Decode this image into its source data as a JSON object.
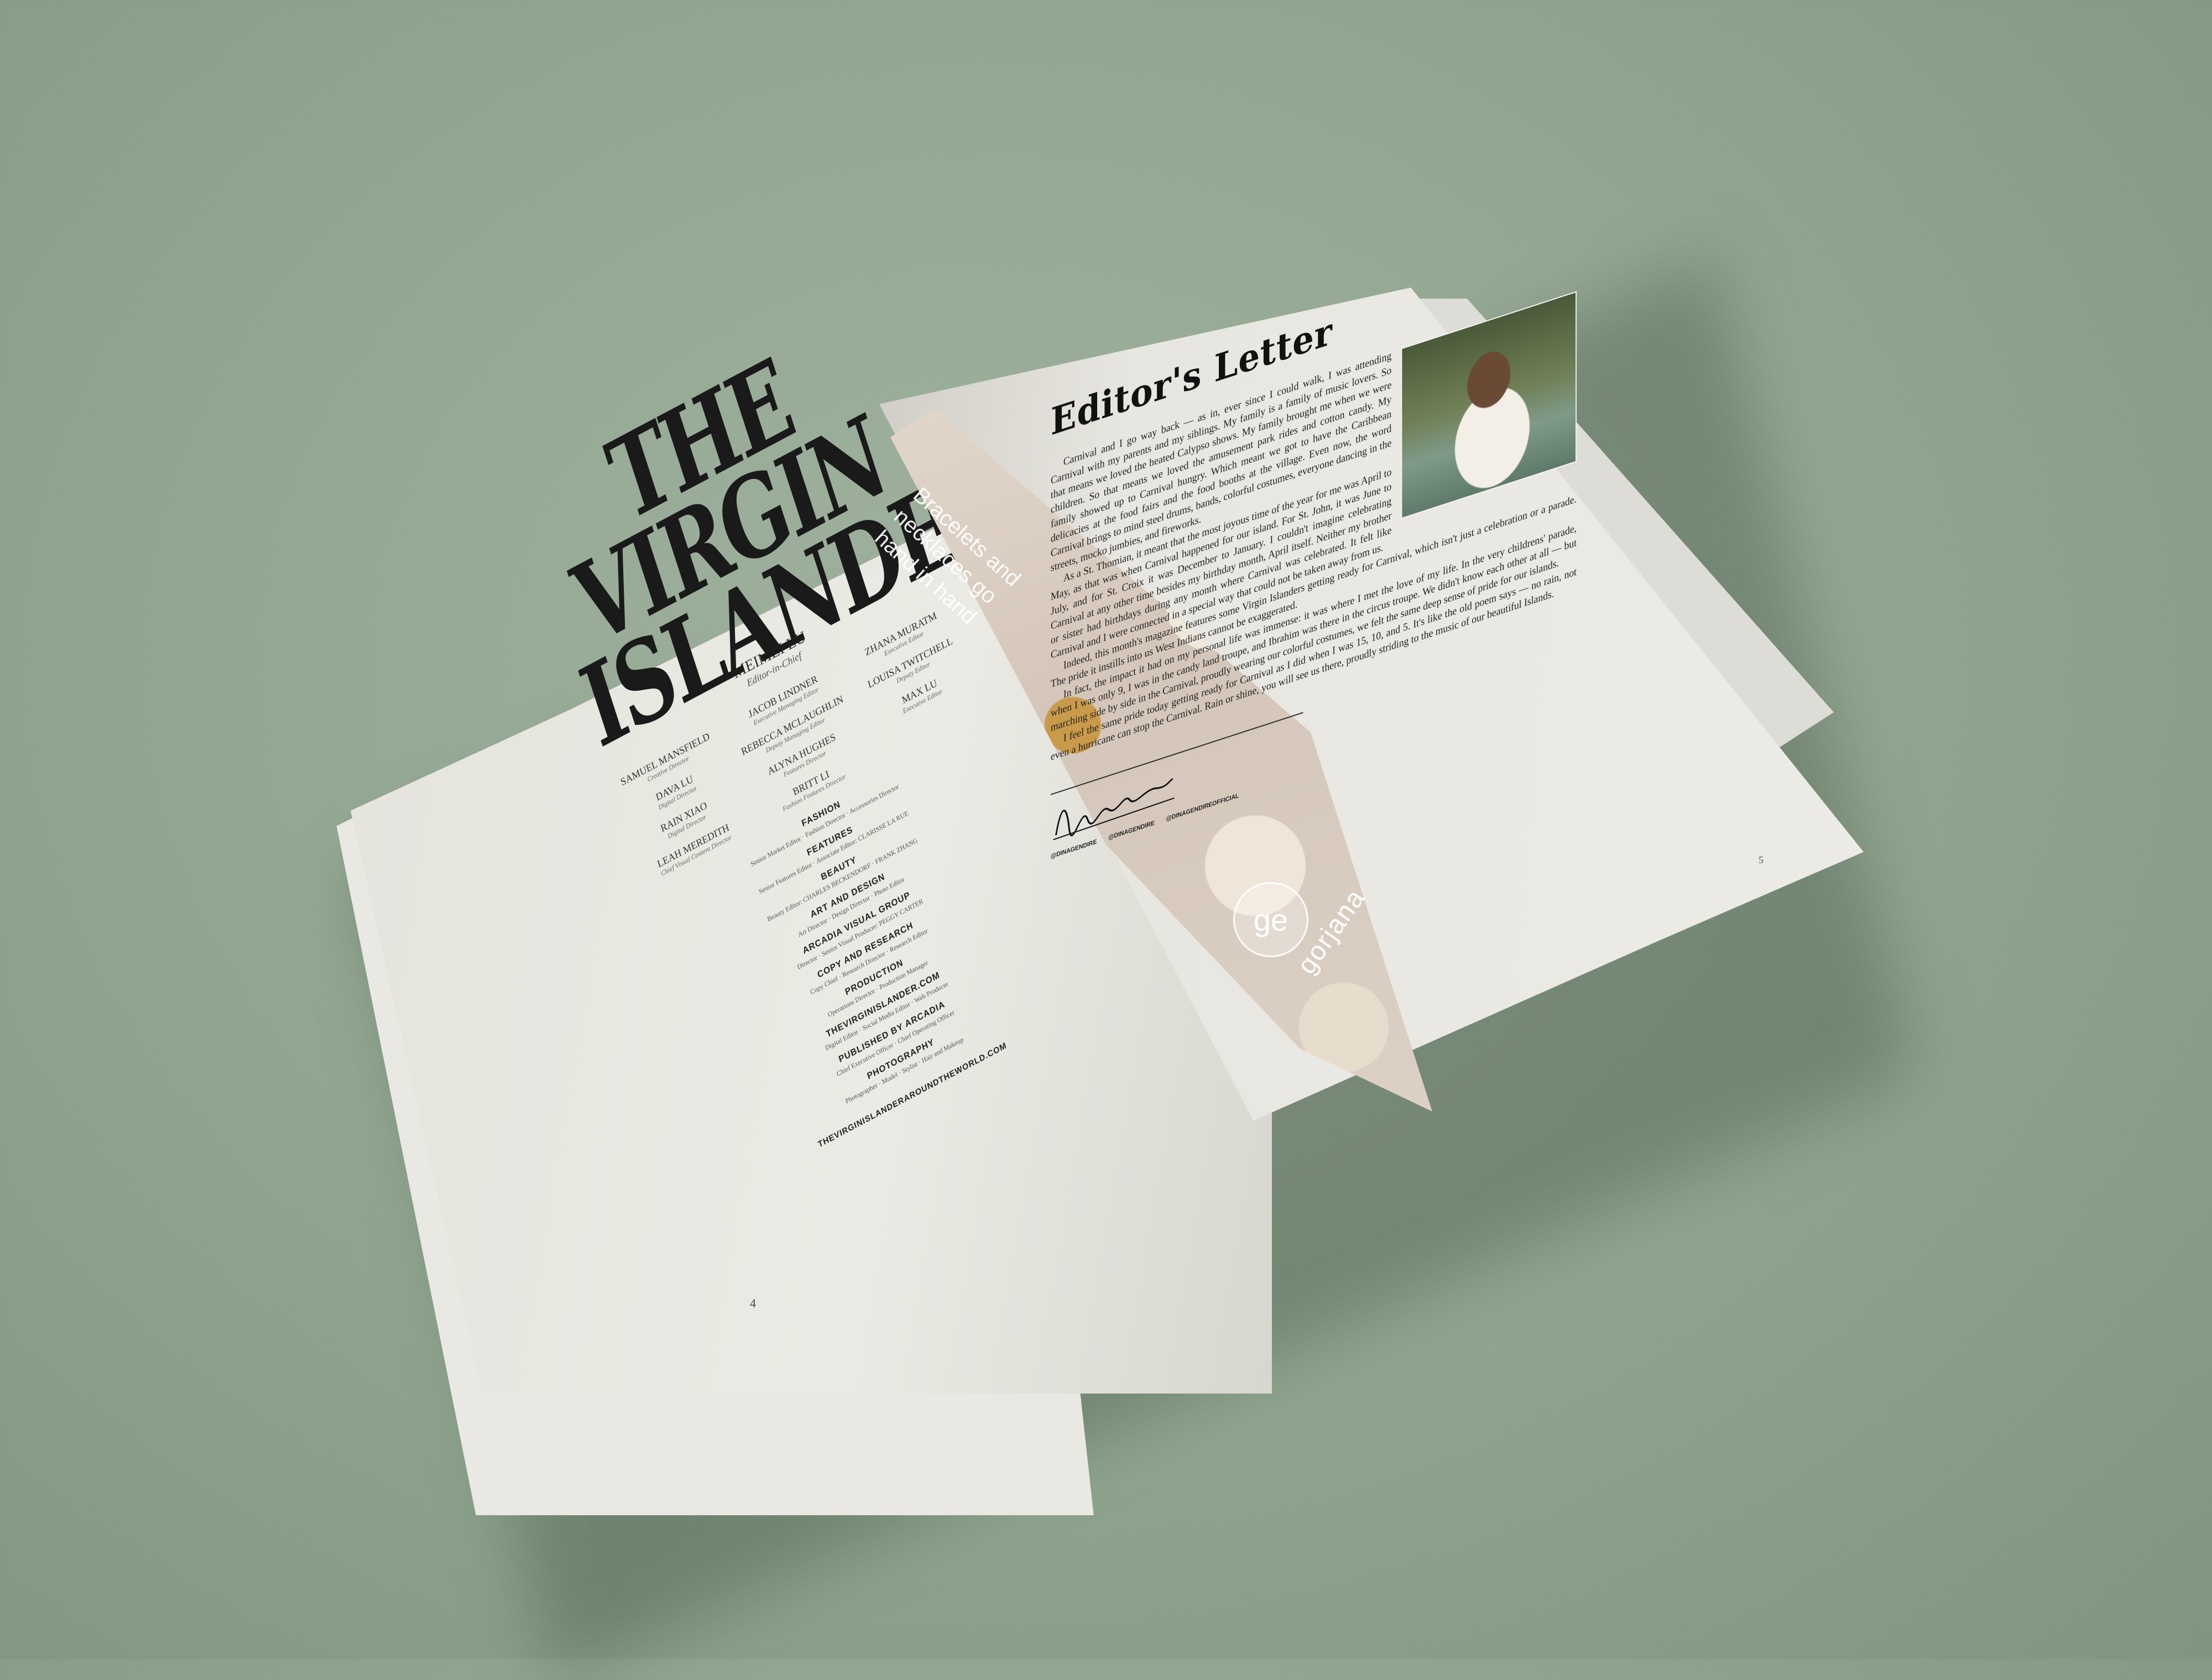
{
  "masthead": {
    "title_line1": "THE VIRGIN",
    "title_line2": "ISLANDER",
    "editor_in_chief": "MEIMEI LU",
    "editor_in_chief_role": "Editor-in-Chief",
    "staff": [
      {
        "name": "SAMUEL MANSFIELD",
        "role": "Creative Director"
      },
      {
        "name": "JACOB LINDNER",
        "role": "Executive Managing Editor"
      },
      {
        "name": "ZHANA MURATM",
        "role": "Executive Editor"
      },
      {
        "name": "DAVA LU",
        "role": "Digital Director"
      },
      {
        "name": "REBECCA MCLAUGHLIN",
        "role": "Deputy Managing Editor"
      },
      {
        "name": "LOUISA TWITCHELL",
        "role": "Deputy Editor"
      },
      {
        "name": "RAIN XIAO",
        "role": "Digital Director"
      },
      {
        "name": "ALYNA HUGHES",
        "role": "Features Director"
      },
      {
        "name": "MAX LU",
        "role": "Executive Editor"
      },
      {
        "name": "LEAH MEREDITH",
        "role": "Chief Visual Content Director"
      },
      {
        "name": "BRITT LI",
        "role": "Fashion Features Director"
      }
    ],
    "departments": [
      {
        "name": "FASHION",
        "line": "Senior Market Editor · Fashion Director · Accessories Director"
      },
      {
        "name": "FEATURES",
        "line": "Senior Features Editor · Associate Editor: CLARISSE LA RUE"
      },
      {
        "name": "BEAUTY",
        "line": "Beauty Editor: CHARLES BECKENDORF · FRANK ZHANG"
      },
      {
        "name": "ART AND DESIGN",
        "line": "Art Director · Design Director · Photo Editor"
      },
      {
        "name": "ARCADIA VISUAL GROUP",
        "line": "Director · Senior Visual Producer: PEGGY CARTER"
      },
      {
        "name": "COPY AND RESEARCH",
        "line": "Copy Chief · Research Director · Research Editor"
      },
      {
        "name": "PRODUCTION",
        "line": "Operations Director · Production Manager"
      },
      {
        "name": "THEVIRGINISLANDER.COM",
        "line": "Digital Editor · Social Media Editor · Web Producer"
      },
      {
        "name": "PUBLISHED BY ARCADIA",
        "line": "Chief Executive Officer · Chief Operating Officer"
      },
      {
        "name": "PHOTOGRAPHY",
        "line": "Photographer · Model · Stylist · Hair and Makeup"
      }
    ],
    "website": "THEVIRGINISLANDERAROUNDTHEWORLD.COM",
    "page_number": "4"
  },
  "spread": {
    "photo_caption": "Bracelets and necklaces go hand in hand",
    "brand_logo": "ge",
    "brand_name": "gorjana"
  },
  "letter": {
    "title": "Editor's Letter",
    "paragraphs": [
      "Carnival and I go way back — as in, ever since I could walk, I was attending Carnival with my parents and my siblings. My family is a family of music lovers. So that means we loved the heated Calypso shows. My family brought me when we were children. So that means we loved the amusement park rides and cotton candy. My family showed up to Carnival hungry. Which meant we got to have the Caribbean delicacies at the food fairs and the food booths at the village. Even now, the word Carnival brings to mind steel drums, bands, colorful costumes, everyone dancing in the streets, mocko jumbies, and fireworks.",
      "As a St. Thomian, it meant that the most joyous time of the year for me was April to May, as that was when Carnival happened for our island. For St. John, it was June to July, and for St. Croix it was December to January. I couldn't imagine celebrating Carnival at any other time besides my birthday month, April itself. Neither my brother or sister had birthdays during any month where Carnival was celebrated. It felt like Carnival and I were connected in a special way that could not be taken away from us.",
      "Indeed, this month's magazine features some Virgin Islanders getting ready for Carnival, which isn't just a celebration or a parade. The pride it instills into us West Indians cannot be exaggerated.",
      "In fact, the impact it had on my personal life was immense: it was where I met the love of my life. In the very childrens' parade, when I was only 9, I was in the candy land troupe, and Ibrahim was there in the circus troupe. We didn't know each other at all — but marching side by side in the Carnival, proudly wearing our colorful costumes, we felt the same deep sense of pride for our islands.",
      "I feel the same pride today getting ready for Carnival as I did when I was 15, 10, and 5. It's like the old poem says — no rain, not even a hurricane can stop the Carnival. Rain or shine, you will see us there, proudly striding to the music of our beautiful Islands."
    ],
    "socials": [
      "@DINAGENDIRE",
      "@DINAGENDIRE",
      "@DINAGENDIREOFFICIAL"
    ],
    "page_number": "5"
  }
}
